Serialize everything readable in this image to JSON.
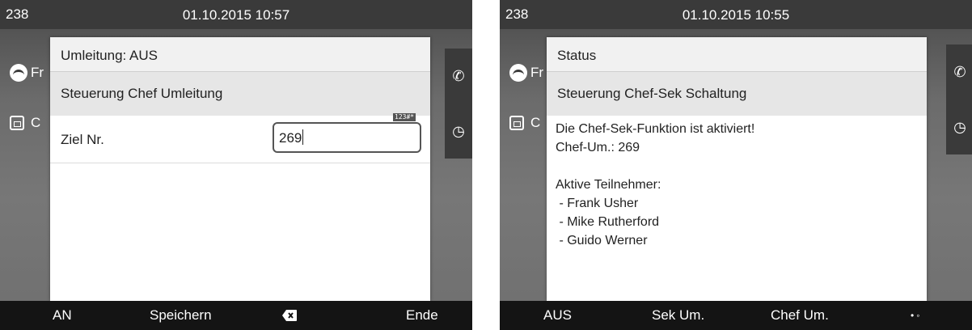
{
  "left": {
    "statusbar": {
      "extension": "238",
      "datetime": "01.10.2015 10:57"
    },
    "bg_rows": [
      "Fr",
      "C"
    ],
    "dialog": {
      "title": "Umleitung: AUS",
      "heading": "Steuerung Chef Umleitung",
      "field_label": "Ziel Nr.",
      "field_value": "269",
      "input_mode": "123#*"
    },
    "softkeys": [
      "AN",
      "Speichern",
      "",
      "Ende"
    ]
  },
  "right": {
    "statusbar": {
      "extension": "238",
      "datetime": "01.10.2015 10:55"
    },
    "bg_rows": [
      "Fr",
      "C"
    ],
    "dialog": {
      "title": "Status",
      "heading": "Steuerung Chef-Sek Schaltung",
      "lines": [
        "Die Chef-Sek-Funktion ist aktiviert!",
        "Chef-Um.: 269",
        "",
        "Aktive Teilnehmer:",
        " - Frank Usher",
        " - Mike Rutherford",
        " - Guido Werner"
      ]
    },
    "softkeys": [
      "AUS",
      "Sek Um.",
      "Chef Um."
    ]
  },
  "icons": {
    "call": "phone-icon",
    "history": "clock-icon",
    "backspace": "backspace-icon",
    "page_indicator": "page-dots-icon"
  }
}
